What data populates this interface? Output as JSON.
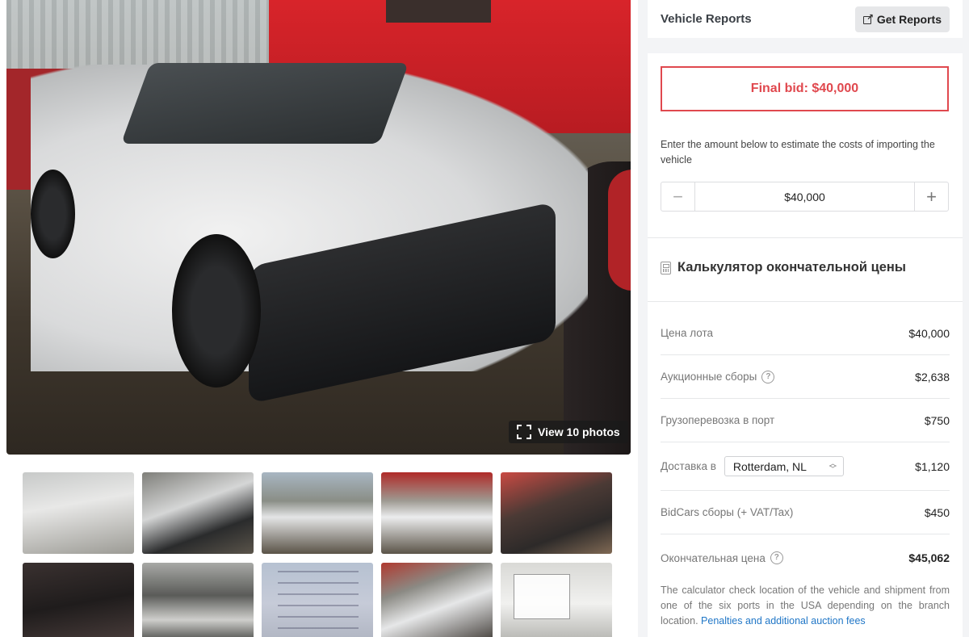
{
  "gallery": {
    "view_photos_label": "View 10 photos",
    "thumbnails": [
      "thumb-1",
      "thumb-2",
      "thumb-3",
      "thumb-4",
      "thumb-5",
      "thumb-6",
      "thumb-7",
      "thumb-8",
      "thumb-9",
      "thumb-10"
    ]
  },
  "reports": {
    "title": "Vehicle Reports",
    "button_label": "Get Reports",
    "button_icon": "external-link-icon"
  },
  "calculator": {
    "final_bid": "Final bid: $40,000",
    "hint": "Enter the amount below to estimate the costs of importing the vehicle",
    "stepper": {
      "minus": "−",
      "value": "$40,000",
      "plus": "+"
    },
    "title": "Калькулятор окончательной цены",
    "title_icon": "calculator-icon",
    "rows": {
      "lot_price": {
        "label": "Цена лота",
        "value": "$40,000"
      },
      "auction_fees": {
        "label": "Аукционные сборы",
        "value": "$2,638"
      },
      "port_shipping": {
        "label": "Грузоперевозка в порт",
        "value": "$750"
      },
      "delivery": {
        "label": "Доставка в",
        "destination": "Rotterdam, NL",
        "value": "$1,120"
      },
      "bidcars_fees": {
        "label": "BidCars сборы (+ VAT/Tax)",
        "value": "$450"
      },
      "final_price": {
        "label": "Окончательная цена",
        "value": "$45,062"
      }
    },
    "note": "The calculator check location of the vehicle and shipment from one of the six ports in the USA depending on the branch location.",
    "note_link": "Penalties and additional auction fees"
  },
  "colors": {
    "accent_red": "#e0484e",
    "link_blue": "#2177c7"
  }
}
